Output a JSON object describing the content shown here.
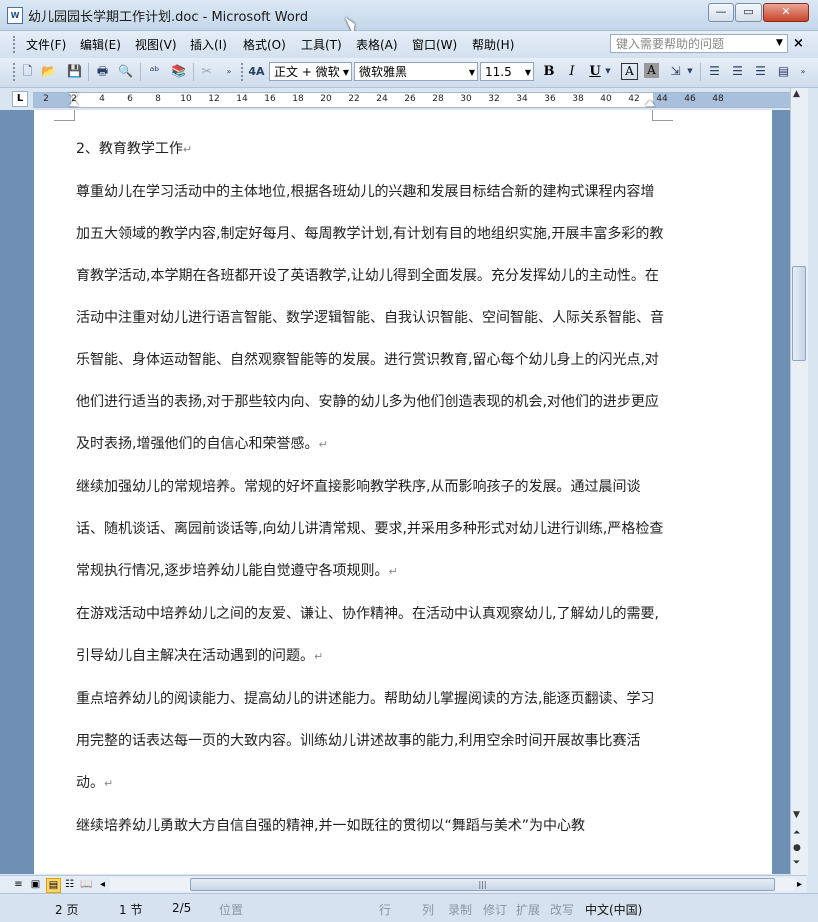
{
  "window": {
    "title": "幼儿园园长学期工作计划.doc - Microsoft Word",
    "app_icon": "W",
    "buttons": {
      "minimize": "—",
      "maximize": "▭",
      "close": "✕"
    }
  },
  "menu": {
    "items": [
      "文件(F)",
      "编辑(E)",
      "视图(V)",
      "插入(I)",
      "格式(O)",
      "工具(T)",
      "表格(A)",
      "窗口(W)",
      "帮助(H)"
    ],
    "help_placeholder": "键入需要帮助的问题",
    "doc_close": "×"
  },
  "toolbar": {
    "style": "正文 + 微软",
    "font": "微软雅黑",
    "size": "11.5",
    "style_marker": "4A",
    "bold": "B",
    "italic": "I",
    "underline": "U",
    "font_color": "A",
    "shading": "A"
  },
  "ruler": {
    "tab_selector": "L",
    "ticks": [
      "2",
      "2",
      "4",
      "6",
      "8",
      "10",
      "12",
      "14",
      "16",
      "18",
      "20",
      "22",
      "24",
      "26",
      "28",
      "30",
      "32",
      "34",
      "36",
      "38",
      "40",
      "42",
      "44",
      "46",
      "48"
    ]
  },
  "document": {
    "paragraphs": [
      {
        "text": "2、教育教学工作",
        "mark": "↵"
      },
      {
        "text": "尊重幼儿在学习活动中的主体地位,根据各班幼儿的兴趣和发展目标结合新的建构式课程内容增加五大领域的教学内容,制定好每月、每周教学计划,有计划有目的地组织实施,开展丰富多彩的教育教学活动,本学期在各班都开设了英语教学,让幼儿得到全面发展。充分发挥幼儿的主动性。在活动中注重对幼儿进行语言智能、数学逻辑智能、自我认识智能、空间智能、人际关系智能、音乐智能、身体运动智能、自然观察智能等的发展。进行赏识教育,留心每个幼儿身上的闪光点,对他们进行适当的表扬,对于那些较内向、安静的幼儿多为他们创造表现的机会,对他们的进步更应及时表扬,增强他们的自信心和荣誉感。",
        "mark": "↵"
      },
      {
        "text": "继续加强幼儿的常规培养。常规的好坏直接影响教学秩序,从而影响孩子的发展。通过晨间谈话、随机谈话、离园前谈话等,向幼儿讲清常规、要求,并采用多种形式对幼儿进行训练,严格检查常规执行情况,逐步培养幼儿能自觉遵守各项规则。",
        "mark": "↵"
      },
      {
        "text": "在游戏活动中培养幼儿之间的友爱、谦让、协作精神。在活动中认真观察幼儿,了解幼儿的需要,引导幼儿自主解决在活动遇到的问题。",
        "mark": "↵"
      },
      {
        "text": "重点培养幼儿的阅读能力、提高幼儿的讲述能力。帮助幼儿掌握阅读的方法,能逐页翻读、学习用完整的话表达每一页的大致内容。训练幼儿讲述故事的能力,利用空余时间开展故事比赛活动。",
        "mark": "↵"
      },
      {
        "text": "继续培养幼儿勇敢大方自信自强的精神,并一如既往的贯彻以“舞蹈与美术”为中心教",
        "mark": ""
      }
    ]
  },
  "status": {
    "page": "2 页",
    "section": "1 节",
    "pages": "2/5",
    "at": "位置",
    "line": "行",
    "col": "列",
    "rec": "录制",
    "trk": "修订",
    "ext": "扩展",
    "ovr": "改写",
    "lang": "中文(中国)"
  }
}
